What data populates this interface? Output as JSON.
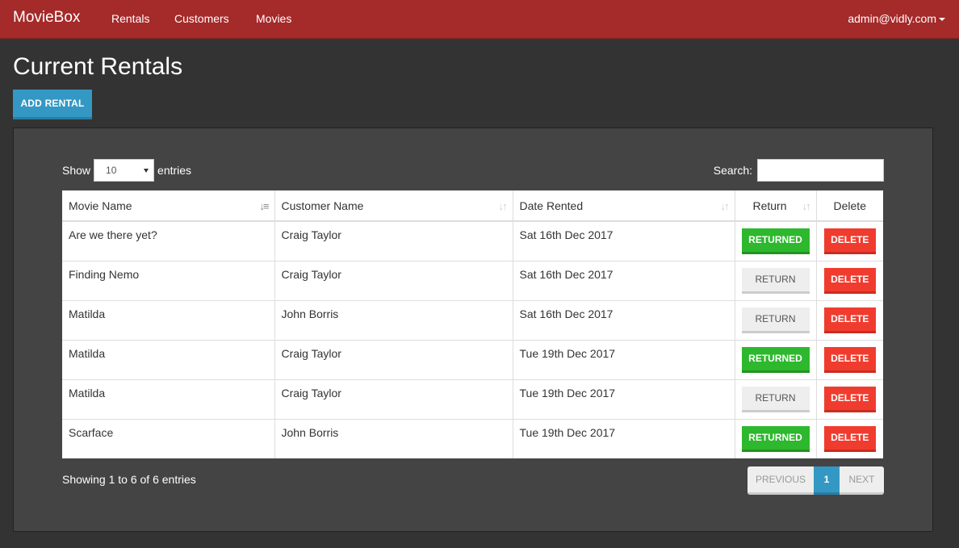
{
  "navbar": {
    "brand": "MovieBox",
    "links": [
      "Rentals",
      "Customers",
      "Movies"
    ],
    "user": "admin@vidly.com"
  },
  "page": {
    "title": "Current Rentals",
    "add_button": "ADD RENTAL"
  },
  "table_controls": {
    "show_label": "Show",
    "length_value": "10",
    "entries_label": "entries",
    "search_label": "Search:",
    "search_value": ""
  },
  "table": {
    "columns": [
      "Movie Name",
      "Customer Name",
      "Date Rented",
      "Return",
      "Delete"
    ],
    "rows": [
      {
        "movie": "Are we there yet?",
        "customer": "Craig Taylor",
        "date": "Sat 16th Dec 2017",
        "return_label": "RETURNED",
        "returned": true,
        "delete_label": "DELETE"
      },
      {
        "movie": "Finding Nemo",
        "customer": "Craig Taylor",
        "date": "Sat 16th Dec 2017",
        "return_label": "RETURN",
        "returned": false,
        "delete_label": "DELETE"
      },
      {
        "movie": "Matilda",
        "customer": "John Borris",
        "date": "Sat 16th Dec 2017",
        "return_label": "RETURN",
        "returned": false,
        "delete_label": "DELETE"
      },
      {
        "movie": "Matilda",
        "customer": "Craig Taylor",
        "date": "Tue 19th Dec 2017",
        "return_label": "RETURNED",
        "returned": true,
        "delete_label": "DELETE"
      },
      {
        "movie": "Matilda",
        "customer": "Craig Taylor",
        "date": "Tue 19th Dec 2017",
        "return_label": "RETURN",
        "returned": false,
        "delete_label": "DELETE"
      },
      {
        "movie": "Scarface",
        "customer": "John Borris",
        "date": "Tue 19th Dec 2017",
        "return_label": "RETURNED",
        "returned": true,
        "delete_label": "DELETE"
      }
    ]
  },
  "footer": {
    "info": "Showing 1 to 6 of 6 entries",
    "previous": "PREVIOUS",
    "current_page": "1",
    "next": "NEXT"
  },
  "colors": {
    "navbar": "#a52a2a",
    "background": "#333333",
    "panel": "#444444",
    "primary": "#3498c4",
    "success": "#2db82d",
    "danger": "#f03c2e"
  },
  "icons": {
    "sort_active": "sort-alpha-asc-icon",
    "sort_inactive": "sort-both-icon",
    "dropdown": "caret-down-icon"
  }
}
